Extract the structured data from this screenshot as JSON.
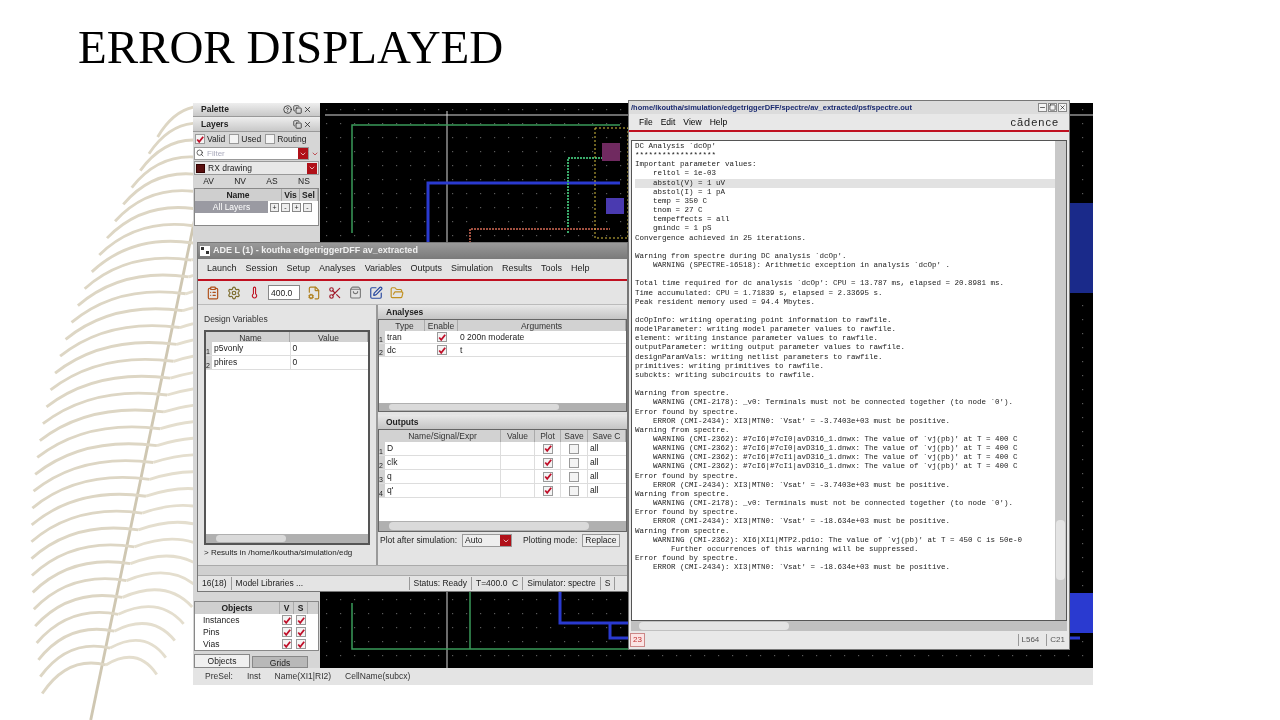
{
  "slide": {
    "title": "ERROR DISPLAYED"
  },
  "palette": {
    "title": "Palette"
  },
  "layers": {
    "title": "Layers",
    "filters": [
      {
        "label": "Valid",
        "checked": true
      },
      {
        "label": "Used",
        "checked": false
      },
      {
        "label": "Routing",
        "checked": false
      }
    ],
    "search": {
      "placeholder": "Filter"
    },
    "current_layer": "RX drawing",
    "tabs": [
      "AV",
      "NV",
      "AS",
      "NS"
    ],
    "columns": [
      "Name",
      "Vis",
      "Sel"
    ],
    "rows": [
      {
        "name": "All Layers",
        "buttons": [
          "+",
          "-",
          "+",
          "-"
        ]
      }
    ]
  },
  "objects": {
    "columns": [
      "Objects",
      "V",
      "S"
    ],
    "rows": [
      {
        "name": "Instances",
        "v": true,
        "s": true
      },
      {
        "name": "Pins",
        "v": true,
        "s": true
      },
      {
        "name": "Vias",
        "v": true,
        "s": true
      }
    ],
    "tabs": [
      {
        "label": "Objects",
        "selected": true
      },
      {
        "label": "Grids",
        "selected": false
      }
    ]
  },
  "status_bar": {
    "items": [
      "PreSel:",
      "Inst",
      "Name(XI1|RI2)",
      "CellName(subcx)"
    ]
  },
  "ade_window": {
    "title": "ADE L (1) - koutha edgetriggerDFF av_extracted",
    "menu": [
      "Launch",
      "Session",
      "Setup",
      "Analyses",
      "Variables",
      "Outputs",
      "Simulation",
      "Results",
      "Tools",
      "Help"
    ],
    "temperature": "400.0",
    "design_variables": {
      "label": "Design Variables",
      "columns": [
        "Name",
        "Value"
      ],
      "rows": [
        {
          "index": "1",
          "name": "p5vonly",
          "value": "0"
        },
        {
          "index": "2",
          "name": "phires",
          "value": "0"
        }
      ]
    },
    "results_path": "> Results in /home/lkoutha/simulation/edg",
    "analyses": {
      "title": "Analyses",
      "columns": [
        "Type",
        "Enable",
        "Arguments"
      ],
      "rows": [
        {
          "index": "1",
          "type": "tran",
          "enabled": true,
          "arguments": "0 200n moderate"
        },
        {
          "index": "2",
          "type": "dc",
          "enabled": true,
          "arguments": "t"
        }
      ]
    },
    "outputs": {
      "title": "Outputs",
      "columns": [
        "Name/Signal/Expr",
        "Value",
        "Plot",
        "Save",
        "Save C"
      ],
      "rows": [
        {
          "index": "1",
          "name": "D",
          "plot": true,
          "save": false,
          "save_option": "all"
        },
        {
          "index": "2",
          "name": "clk",
          "plot": true,
          "save": false,
          "save_option": "all"
        },
        {
          "index": "3",
          "name": "q",
          "plot": true,
          "save": false,
          "save_option": "all"
        },
        {
          "index": "4",
          "name": "q'",
          "plot": true,
          "save": false,
          "save_option": "all"
        }
      ]
    },
    "plot_after_label": "Plot after simulation:",
    "plot_after": "Auto",
    "plotting_mode_label": "Plotting mode:",
    "plotting_mode": "Replace",
    "status": [
      "16(18)",
      "Model Libraries ...",
      "Status: Ready",
      "T=400.0  C",
      "Simulator: spectre",
      "S"
    ]
  },
  "spectre_window": {
    "title": "/home/lkoutha/simulation/edgetriggerDFF/spectre/av_extracted/psf/spectre.out",
    "menu": [
      "File",
      "Edit",
      "View",
      "Help"
    ],
    "logo": "cādence",
    "log": [
      {
        "lines": [
          {
            "text": "DC Analysis `dcOp'",
            "selected": false
          },
          {
            "text": "******************",
            "selected": false
          },
          {
            "text": "Important parameter values:",
            "selected": false
          },
          {
            "text": "    reltol = 1e-03",
            "selected": false
          },
          {
            "text": "    abstol(V) = 1 uV",
            "selected": true
          },
          {
            "text": "    abstol(I) = 1 pA",
            "selected": false
          },
          {
            "text": "    temp = 350 C",
            "selected": false
          },
          {
            "text": "    tnom = 27 C",
            "selected": false
          },
          {
            "text": "    tempeffects = all",
            "selected": false
          },
          {
            "text": "    gmindc = 1 pS",
            "selected": false
          },
          {
            "text": "Convergence achieved in 25 iterations.",
            "selected": false
          }
        ]
      },
      {
        "lines": [
          {
            "text": "Warning from spectre during DC analysis `dcOp'.",
            "selected": false
          },
          {
            "text": "    WARNING (SPECTRE-16518): Arithmetic exception in analysis `dcOp' .",
            "selected": false
          }
        ]
      },
      {
        "lines": [
          {
            "text": "Total time required for dc analysis `dcOp': CPU = 13.787 ms, elapsed = 20.8981 ms.",
            "selected": false
          },
          {
            "text": "Time accumulated: CPU = 1.71839 s, elapsed = 2.33695 s.",
            "selected": false
          },
          {
            "text": "Peak resident memory used = 94.4 Mbytes.",
            "selected": false
          }
        ]
      },
      {
        "lines": [
          {
            "text": "dcOpInfo: writing operating point information to rawfile.",
            "selected": false
          },
          {
            "text": "modelParameter: writing model parameter values to rawfile.",
            "selected": false
          },
          {
            "text": "element: writing instance parameter values to rawfile.",
            "selected": false
          },
          {
            "text": "outputParameter: writing output parameter values to rawfile.",
            "selected": false
          },
          {
            "text": "designParamVals: writing netlist parameters to rawfile.",
            "selected": false
          },
          {
            "text": "primitives: writing primitives to rawfile.",
            "selected": false
          },
          {
            "text": "subckts: writing subcircuits to rawfile.",
            "selected": false
          }
        ]
      },
      {
        "lines": [
          {
            "text": "Warning from spectre.",
            "selected": false
          },
          {
            "text": "    WARNING (CMI-2178): _v0: Terminals must not be connected together (to node `0').",
            "selected": false
          },
          {
            "text": "Error found by spectre.",
            "selected": false
          },
          {
            "text": "    ERROR (CMI-2434): XI3|MTN0: `Vsat' = -3.7403e+03 must be positive.",
            "selected": false
          },
          {
            "text": "Warning from spectre.",
            "selected": false
          },
          {
            "text": "    WARNING (CMI-2362): #7cI6|#7cI0|avD316_1.dnwx: The value of `vj(pb)' at T = 400 C",
            "selected": false
          },
          {
            "text": "    WARNING (CMI-2362): #7cI6|#7cI0|avD316_1.dnwx: The value of `vj(pb)' at T = 400 C",
            "selected": false
          },
          {
            "text": "    WARNING (CMI-2362): #7cI6|#7cI1|avD316_1.dnwx: The value of `vj(pb)' at T = 400 C",
            "selected": false
          },
          {
            "text": "    WARNING (CMI-2362): #7cI6|#7cI1|avD316_1.dnwx: The value of `vj(pb)' at T = 400 C",
            "selected": false
          },
          {
            "text": "Error found by spectre.",
            "selected": false
          },
          {
            "text": "    ERROR (CMI-2434): XI3|MTN0: `Vsat' = -3.7403e+03 must be positive.",
            "selected": false
          },
          {
            "text": "Warning from spectre.",
            "selected": false
          },
          {
            "text": "    WARNING (CMI-2178): _v0: Terminals must not be connected together (to node `0').",
            "selected": false
          },
          {
            "text": "Error found by spectre.",
            "selected": false
          },
          {
            "text": "    ERROR (CMI-2434): XI3|MTN0: `Vsat' = -18.634e+03 must be positive.",
            "selected": false
          },
          {
            "text": "Warning from spectre.",
            "selected": false
          },
          {
            "text": "    WARNING (CMI-2362): XI6|XI1|MTP2.pdio: The value of `vj(pb)' at T = 450 C is 50e-0",
            "selected": false
          },
          {
            "text": "        Further occurrences of this warning will be suppressed.",
            "selected": false
          },
          {
            "text": "Error found by spectre.",
            "selected": false
          },
          {
            "text": "    ERROR (CMI-2434): XI3|MTN0: `Vsat' = -18.634e+03 must be positive.",
            "selected": false
          }
        ]
      }
    ],
    "status": {
      "count": "23",
      "line": "L564",
      "column": "C21"
    }
  }
}
